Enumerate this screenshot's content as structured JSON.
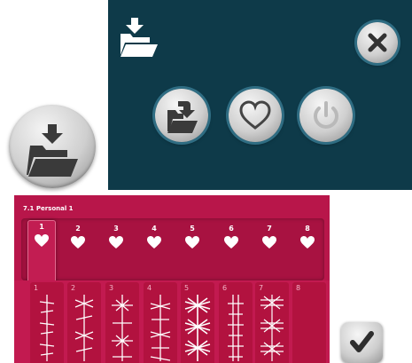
{
  "colors": {
    "dialog_bg": "#0e3a49",
    "menu_bg": "#b8164a",
    "accent_ring": "#2f6d83",
    "icon_dark": "#3a3a3a"
  },
  "icons": {
    "big_load": "folder-load-icon",
    "dialog_header": "folder-load-icon",
    "close": "close-icon",
    "open": "folder-open-icon",
    "favorite": "heart-icon",
    "power": "power-icon",
    "ok": "checkmark-icon"
  },
  "menu": {
    "title": "7.1 Personal 1",
    "tabs": [
      {
        "label": "1",
        "active": true
      },
      {
        "label": "2",
        "active": false
      },
      {
        "label": "3",
        "active": false
      },
      {
        "label": "4",
        "active": false
      },
      {
        "label": "5",
        "active": false
      },
      {
        "label": "6",
        "active": false
      },
      {
        "label": "7",
        "active": false
      },
      {
        "label": "8",
        "active": false
      }
    ],
    "stitch_slots": [
      {
        "label": "1",
        "filled": true
      },
      {
        "label": "2",
        "filled": true
      },
      {
        "label": "3",
        "filled": true
      },
      {
        "label": "4",
        "filled": true
      },
      {
        "label": "5",
        "filled": true
      },
      {
        "label": "6",
        "filled": true
      },
      {
        "label": "7",
        "filled": true
      },
      {
        "label": "8",
        "filled": false
      }
    ]
  }
}
